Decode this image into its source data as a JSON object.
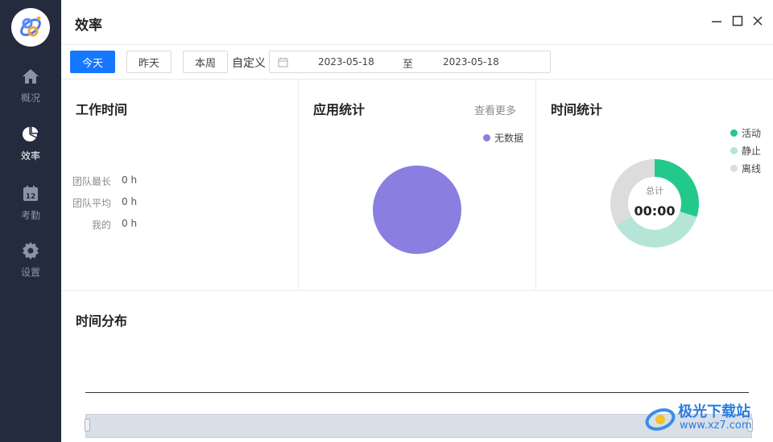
{
  "sidebar": {
    "items": [
      {
        "label": "概况",
        "icon": "home-icon"
      },
      {
        "label": "效率",
        "icon": "pie-chart-icon",
        "active": true
      },
      {
        "label": "考勤",
        "icon": "calendar-icon"
      },
      {
        "label": "设置",
        "icon": "gear-icon"
      }
    ],
    "calendar_icon_number": "12"
  },
  "header": {
    "title": "效率"
  },
  "toolbar": {
    "today": "今天",
    "yesterday": "昨天",
    "this_week": "本周",
    "custom_label": "自定义",
    "date_from": "2023-05-18",
    "date_sep": "至",
    "date_to": "2023-05-18"
  },
  "work_time": {
    "title": "工作时间",
    "rows": [
      {
        "label": "团队最长",
        "value": "0 h"
      },
      {
        "label": "团队平均",
        "value": "0 h"
      },
      {
        "label": "我的",
        "value": "0 h"
      }
    ]
  },
  "app_stats": {
    "title": "应用统计",
    "more": "查看更多",
    "legend": "无数据",
    "color": "#8a7fe0"
  },
  "time_stats": {
    "title": "时间统计",
    "center_label": "总计",
    "center_value": "00:00",
    "legend": [
      {
        "label": "活动",
        "color": "#22c98a"
      },
      {
        "label": "静止",
        "color": "#b5e5d6"
      },
      {
        "label": "离线",
        "color": "#dcdcdc"
      }
    ]
  },
  "distribution": {
    "title": "时间分布"
  },
  "watermark": {
    "text": "极光下载站",
    "url": "www.xz7.com"
  },
  "colors": {
    "accent": "#1677ff",
    "sidebar": "#242b3d"
  }
}
